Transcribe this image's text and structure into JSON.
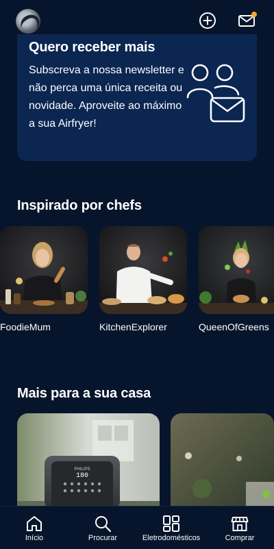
{
  "header": {
    "logo_icon": "philips-chef-logo",
    "add_icon": "plus-circle-icon",
    "inbox_icon": "envelope-icon",
    "notification_color": "#f4a630"
  },
  "newsletter": {
    "title": "Quero receber mais",
    "body": "Subscreva a nossa newsletter e não perca uma única receita ou novidade. Aproveite ao máximo a sua Airfryer!",
    "illustration_icon": "users-mail-icon"
  },
  "chefs_section": {
    "title": "Inspirado por chefs",
    "chefs": [
      {
        "name": "FoodieMum"
      },
      {
        "name": "KitchenExplorer"
      },
      {
        "name": "QueenOfGreens"
      }
    ]
  },
  "home_section": {
    "title": "Mais para a sua casa",
    "airfryer_display": "180",
    "airfryer_brand": "PHILIPS"
  },
  "bottom_nav": {
    "items": [
      {
        "label": "Início",
        "icon": "home-icon"
      },
      {
        "label": "Procurar",
        "icon": "search-icon"
      },
      {
        "label": "Eletrodomésticos",
        "icon": "appliances-grid-icon"
      },
      {
        "label": "Comprar",
        "icon": "store-icon"
      }
    ]
  },
  "colors": {
    "background": "#07152c",
    "card": "#0b2651",
    "accent": "#f4a630"
  }
}
